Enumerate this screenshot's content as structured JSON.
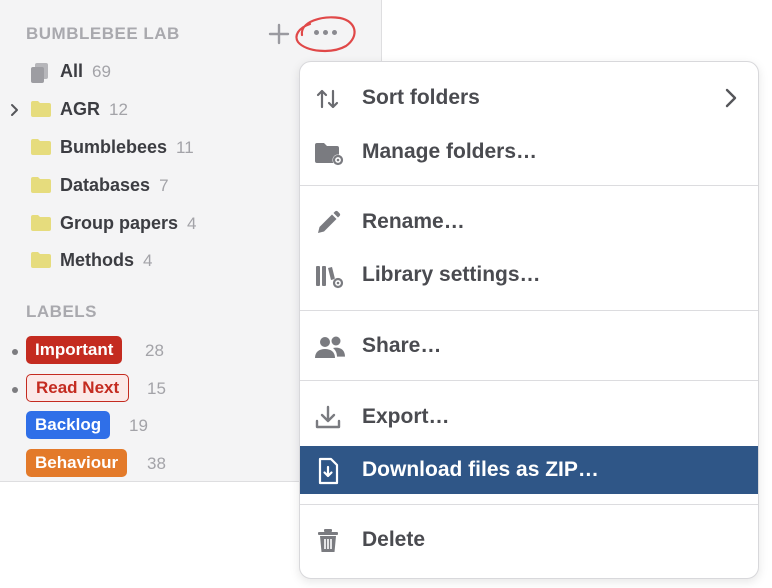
{
  "sidebar": {
    "library_title": "BUMBLEBEE LAB",
    "all": {
      "label": "All",
      "count": "69"
    },
    "folders": [
      {
        "label": "AGR",
        "count": "12",
        "expandable": true
      },
      {
        "label": "Bumblebees",
        "count": "11"
      },
      {
        "label": "Databases",
        "count": "7"
      },
      {
        "label": "Group papers",
        "count": "4"
      },
      {
        "label": "Methods",
        "count": "4"
      }
    ],
    "labels_title": "LABELS",
    "labels": [
      {
        "label": "Important",
        "count": "28",
        "style": "solid",
        "color": "#c42b20",
        "dot": true
      },
      {
        "label": "Read Next",
        "count": "15",
        "style": "outline",
        "color": "#c42b20",
        "dot": true
      },
      {
        "label": "Backlog",
        "count": "19",
        "style": "solid",
        "color": "#2f6fe8",
        "dot": false
      },
      {
        "label": "Behaviour",
        "count": "38",
        "style": "solid",
        "color": "#e37a2a",
        "dot": false
      }
    ]
  },
  "icons": {
    "add": "plus-icon",
    "more": "more-horizontal-icon",
    "folder_color": "#e6dc7d"
  },
  "menu": {
    "items": [
      {
        "label": "Sort folders",
        "icon": "sort-icon",
        "submenu": true
      },
      {
        "label": "Manage folders…",
        "icon": "folder-gear-icon"
      },
      {
        "label": "Rename…",
        "icon": "pencil-icon"
      },
      {
        "label": "Library settings…",
        "icon": "library-gear-icon"
      },
      {
        "label": "Share…",
        "icon": "users-icon"
      },
      {
        "label": "Export…",
        "icon": "download-tray-icon"
      },
      {
        "label": "Download files as ZIP…",
        "icon": "file-download-icon",
        "selected": true
      },
      {
        "label": "Delete",
        "icon": "trash-icon"
      }
    ],
    "selected_color": "#2f5687"
  }
}
